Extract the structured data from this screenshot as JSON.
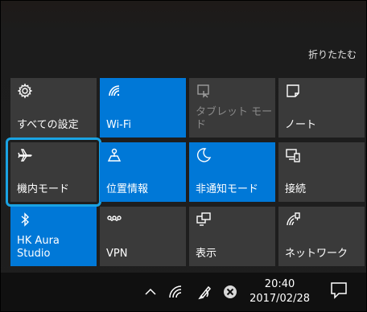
{
  "collapse_label": "折りたたむ",
  "tiles": [
    {
      "label": "すべての設定",
      "icon": "gear-icon",
      "state": "off"
    },
    {
      "label": "Wi-Fi",
      "icon": "wifi-icon",
      "state": "on"
    },
    {
      "label": "タブレット モード",
      "icon": "tablet-mode-icon",
      "state": "disabled"
    },
    {
      "label": "ノート",
      "icon": "note-icon",
      "state": "off"
    },
    {
      "label": "機内モード",
      "icon": "airplane-icon",
      "state": "off"
    },
    {
      "label": "位置情報",
      "icon": "location-icon",
      "state": "on"
    },
    {
      "label": "非通知モード",
      "icon": "moon-icon",
      "state": "on"
    },
    {
      "label": "接続",
      "icon": "connect-icon",
      "state": "off"
    },
    {
      "label": "HK Aura\nStudio",
      "icon": "bluetooth-icon",
      "state": "on"
    },
    {
      "label": "VPN",
      "icon": "vpn-icon",
      "state": "off"
    },
    {
      "label": "表示",
      "icon": "display-icon",
      "state": "off"
    },
    {
      "label": "ネットワーク",
      "icon": "network-icon",
      "state": "off"
    }
  ],
  "taskbar": {
    "time": "20:40",
    "date": "2017/02/28",
    "icons": [
      "chevron-up-icon",
      "wifi-icon",
      "pen-icon",
      "close-icon",
      "notification-icon"
    ]
  },
  "colors": {
    "accent": "#0078d7",
    "tile_off": "#3a3a3a",
    "focus_outline": "#1aa3e3"
  }
}
